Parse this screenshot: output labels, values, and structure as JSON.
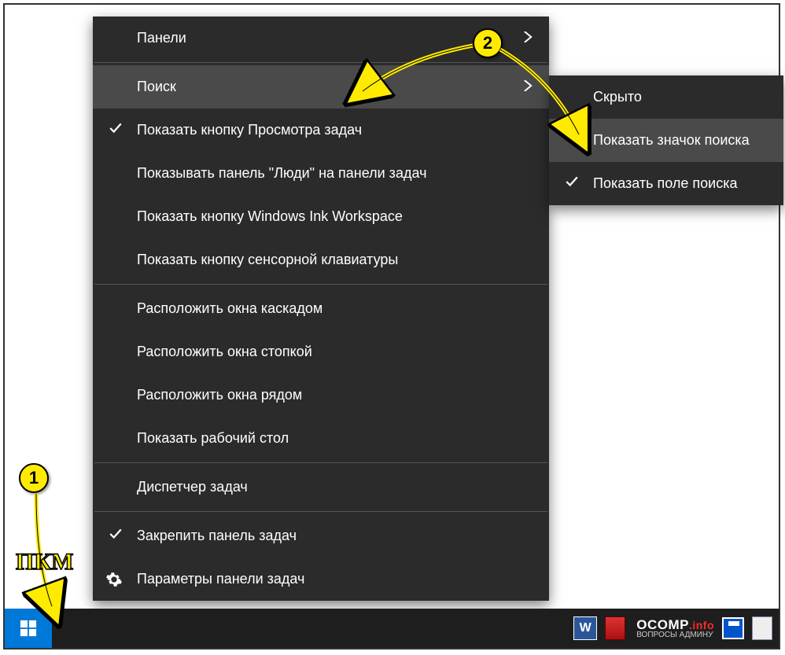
{
  "main_menu": {
    "panels": "Панели",
    "search": "Поиск",
    "task_view": "Показать кнопку Просмотра задач",
    "people": "Показывать панель \"Люди\" на панели задач",
    "ink": "Показать кнопку Windows Ink Workspace",
    "touch_kb": "Показать кнопку сенсорной клавиатуры",
    "cascade": "Расположить окна каскадом",
    "stacked": "Расположить окна стопкой",
    "side": "Расположить окна рядом",
    "show_desktop": "Показать рабочий стол",
    "task_mgr": "Диспетчер задач",
    "lock_tb": "Закрепить панель задач",
    "tb_settings": "Параметры панели задач"
  },
  "sub_menu": {
    "hidden": "Скрыто",
    "show_icon": "Показать значок поиска",
    "show_box": "Показать поле поиска"
  },
  "annotations": {
    "badge1": "1",
    "badge2": "2",
    "pkm": "ПКМ"
  },
  "branding": {
    "ocomp": "OCOMP",
    "info": ".info",
    "tagline": "ВОПРОСЫ АДМИНУ",
    "word_letter": "W"
  }
}
